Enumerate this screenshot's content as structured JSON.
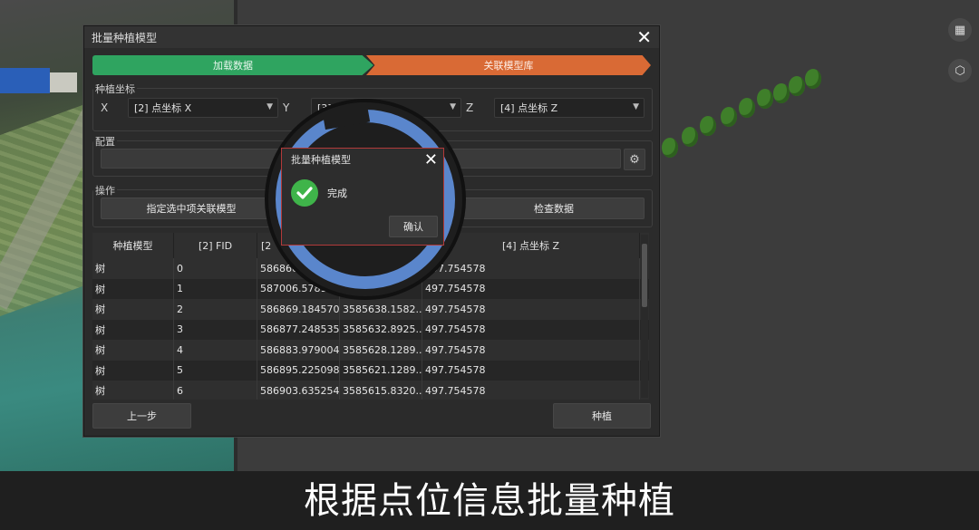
{
  "dialog": {
    "title": "批量种植模型",
    "steps": [
      "加载数据",
      "关联模型库"
    ],
    "coords": {
      "label": "种植坐标",
      "x_label": "X",
      "x_value": "[2] 点坐标 X",
      "y_label": "Y",
      "y_value": "[3]",
      "z_label": "Z",
      "z_value": "[4] 点坐标 Z"
    },
    "config": {
      "label": "配置"
    },
    "ops": {
      "label": "操作",
      "assign_button": "指定选中项关联模型",
      "check_button": "检查数据"
    },
    "table": {
      "headers": [
        "种植模型",
        "[2] FID",
        "[2",
        "",
        "[4] 点坐标 Z"
      ],
      "rows": [
        [
          "树",
          "0",
          "586860.",
          "",
          "497.754578"
        ],
        [
          "树",
          "1",
          "587006.578125",
          "...43...",
          "497.754578"
        ],
        [
          "树",
          "2",
          "586869.184570",
          "3585638.1582...",
          "497.754578"
        ],
        [
          "树",
          "3",
          "586877.248535",
          "3585632.8925...",
          "497.754578"
        ],
        [
          "树",
          "4",
          "586883.979004",
          "3585628.1289...",
          "497.754578"
        ],
        [
          "树",
          "5",
          "586895.225098",
          "3585621.1289...",
          "497.754578"
        ],
        [
          "树",
          "6",
          "586903.635254",
          "3585615.8320...",
          "497.754578"
        ]
      ]
    },
    "footer": {
      "prev_button": "上一步",
      "plant_button": "种植"
    }
  },
  "popup": {
    "title": "批量种植模型",
    "message": "完成",
    "ok_button": "确认"
  },
  "caption": "根据点位信息批量种植",
  "colors": {
    "step_done": "#2fa460",
    "step_active": "#d96a35",
    "ring": "#5a86cc",
    "success": "#3fb44a"
  }
}
